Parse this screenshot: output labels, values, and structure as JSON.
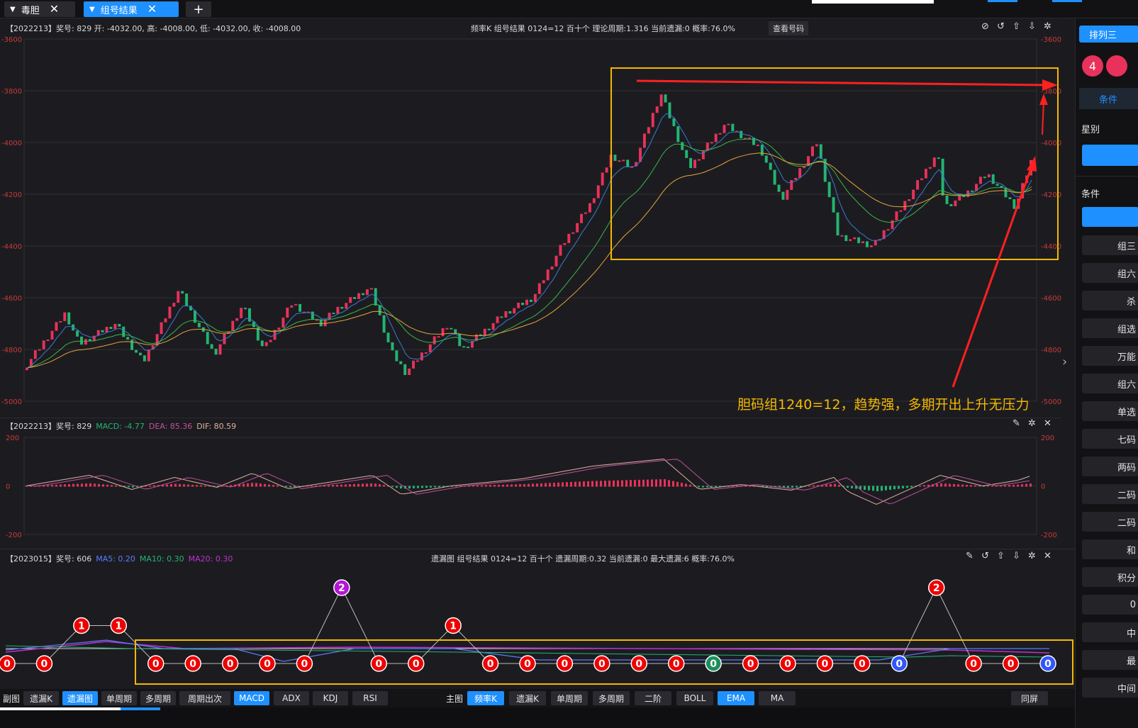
{
  "tabs": [
    {
      "label": "毒胆"
    },
    {
      "label": "组号结果"
    },
    {
      "label": "+"
    }
  ],
  "main_header": {
    "left": "【2022213】奖号: 829  开: -4032.00, 高: -4008.00, 低: -4032.00, 收: -4008.00",
    "center": "频率K  组号结果  0124=12  百十个  理论周期:1.316  当前遗漏:0  概率:76.0%",
    "button": "查看号码"
  },
  "main_axis": [
    "-3600",
    "-3800",
    "-4000",
    "-4200",
    "-4400",
    "-4600",
    "-4800",
    "-5000"
  ],
  "annotation": "胆码组1240=12，趋势强，多期开出上升无压力",
  "macd_header": {
    "prefix": "【2022213】奖号: 829",
    "macd": "MACD: -4.77",
    "dea": "DEA: 85.36",
    "dif": "DIF: 80.59"
  },
  "macd_axis": [
    "200",
    "0",
    "-200"
  ],
  "miss_header": {
    "prefix": "【2023015】奖号: 606",
    "ma5": "MA5: 0.20",
    "ma10": "MA10: 0.30",
    "ma20": "MA20: 0.30",
    "center": "遗漏图  组号结果  0124=12  百十个  遗漏周期:0.32  当前遗漏:0  最大遗漏:6  概率:76.0%"
  },
  "miss_values": [
    0,
    0,
    1,
    1,
    0,
    0,
    0,
    0,
    0,
    2,
    0,
    0,
    1,
    0,
    0,
    0,
    0,
    0,
    0,
    0,
    0,
    0,
    0,
    0,
    0,
    2,
    0,
    0,
    0
  ],
  "bottom_left_label": "副图",
  "bottom_left_buttons": [
    {
      "label": "遗漏K",
      "on": false
    },
    {
      "label": "遗漏图",
      "on": true
    },
    {
      "label": "单周期",
      "on": false
    },
    {
      "label": "多周期",
      "on": false
    },
    {
      "label": "周期出次",
      "on": false
    },
    {
      "label": "MACD",
      "on": true
    },
    {
      "label": "ADX",
      "on": false
    },
    {
      "label": "KDJ",
      "on": false
    },
    {
      "label": "RSI",
      "on": false
    }
  ],
  "bottom_right_label": "主图",
  "bottom_right_buttons": [
    {
      "label": "频率K",
      "on": true
    },
    {
      "label": "遗漏K",
      "on": false
    },
    {
      "label": "单周期",
      "on": false
    },
    {
      "label": "多周期",
      "on": false
    },
    {
      "label": "二阶",
      "on": false
    },
    {
      "label": "BOLL",
      "on": false
    },
    {
      "label": "EMA",
      "on": true
    },
    {
      "label": "MA",
      "on": false
    }
  ],
  "same_screen": "同屏",
  "right_panel": {
    "top_button": "排列三",
    "badge": "4",
    "cond_tab": "条件",
    "section1": "星别",
    "section2": "条件",
    "items": [
      "组三",
      "组六",
      "杀",
      "组选",
      "万能",
      "组六",
      "单选",
      "七码",
      "两码",
      "二码",
      "二码",
      "和",
      "积分",
      "0",
      "中",
      "最",
      "中间"
    ]
  },
  "colors": {
    "up": "#e8315b",
    "down": "#22b573",
    "ema_fast": "#3a7bd5",
    "ema_mid": "#3cb54a",
    "ema_slow": "#e6a23c",
    "highlight": "#f5b800",
    "arrow": "#ff2020",
    "accent": "#1e90ff"
  }
}
